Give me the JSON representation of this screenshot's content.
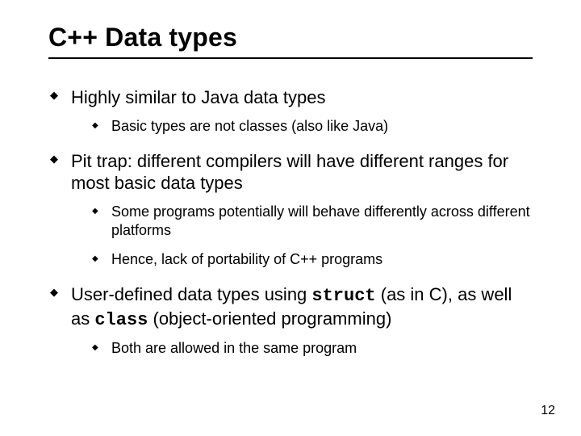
{
  "title": "C++ Data types",
  "bullets": {
    "b1": "Highly similar to Java data types",
    "b1s1": "Basic types are not classes (also like Java)",
    "b2": "Pit trap: different compilers will have different ranges for most basic data types",
    "b2s1": "Some programs potentially will behave differently across different platforms",
    "b2s2": "Hence, lack of portability of C++ programs",
    "b3a": "User-defined data types using ",
    "b3code1": "struct",
    "b3b": " (as in C), as well as ",
    "b3code2": "class",
    "b3c": " (object-oriented programming)",
    "b3s1": "Both are allowed in the same program"
  },
  "page_number": "12"
}
